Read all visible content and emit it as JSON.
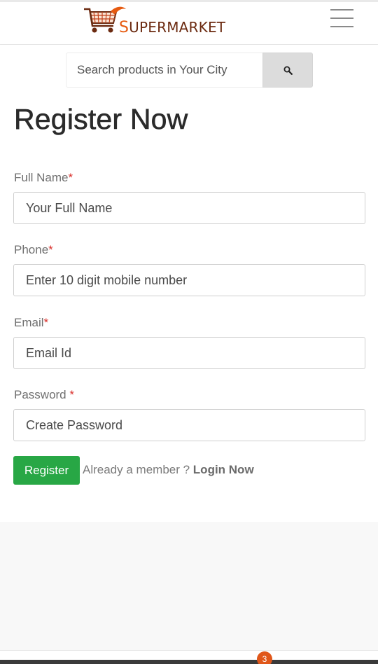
{
  "header": {
    "logo_text_first": "S",
    "logo_text_rest": "UPERMARKET",
    "menu_icon": "hamburger-menu-icon"
  },
  "search": {
    "placeholder": "Search products in Your City",
    "button_icon": "search-icon"
  },
  "form": {
    "title": "Register Now",
    "fields": [
      {
        "label": "Full Name",
        "required_mark": "*",
        "placeholder": "Your Full Name"
      },
      {
        "label": "Phone",
        "required_mark": "*",
        "placeholder": "Enter 10 digit mobile number"
      },
      {
        "label": "Email",
        "required_mark": "*",
        "placeholder": "Email Id"
      },
      {
        "label": "Password ",
        "required_mark": "*",
        "placeholder": "Create Password"
      }
    ],
    "register_label": "Register",
    "member_text": "Already a member ? ",
    "login_label": "Login Now"
  },
  "footer": {
    "cart_count": "3"
  },
  "colors": {
    "primary_green": "#28a745",
    "required_red": "#d9302c",
    "brand_orange": "#e65a10",
    "brand_brown": "#6b2a10",
    "badge_orange": "#e0571a"
  }
}
